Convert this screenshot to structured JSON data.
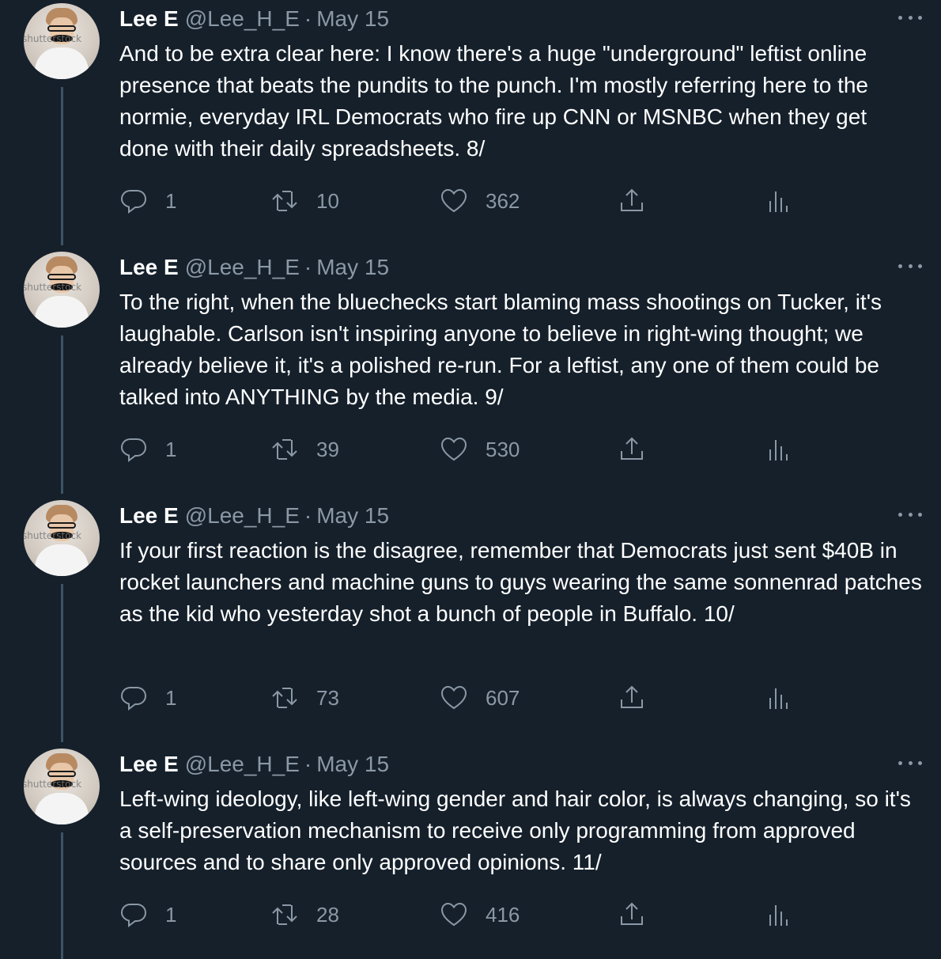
{
  "tweets": [
    {
      "name": "Lee E",
      "handle": "@Lee_H_E",
      "separator": "·",
      "date": "May 15",
      "avatar_watermark": "shutterstock",
      "text": "And to be extra clear here: I know there's a huge \"underground\" leftist online presence that beats the pundits to the punch. I'm mostly referring here to the normie, everyday IRL Democrats who fire up CNN or MSNBC when they get done with their daily spreadsheets. 8/",
      "replies": "1",
      "retweets": "10",
      "likes": "362"
    },
    {
      "name": "Lee E",
      "handle": "@Lee_H_E",
      "separator": "·",
      "date": "May 15",
      "avatar_watermark": "shutterstock",
      "text": "To the right, when the bluechecks start blaming mass shootings on Tucker, it's laughable. Carlson isn't inspiring anyone to believe in right-wing thought; we already believe it, it's a polished re-run. For a leftist, any one of them could be talked into ANYTHING by the media. 9/",
      "replies": "1",
      "retweets": "39",
      "likes": "530"
    },
    {
      "name": "Lee E",
      "handle": "@Lee_H_E",
      "separator": "·",
      "date": "May 15",
      "avatar_watermark": "shutterstock",
      "text": "If your first reaction is the disagree, remember that Democrats just sent $40B in rocket launchers and machine guns to guys wearing the same sonnenrad patches as the kid who yesterday shot a bunch of people in Buffalo. 10/",
      "replies": "1",
      "retweets": "73",
      "likes": "607"
    },
    {
      "name": "Lee E",
      "handle": "@Lee_H_E",
      "separator": "·",
      "date": "May 15",
      "avatar_watermark": "shutterstock",
      "text": "Left-wing ideology, like left-wing gender and hair color, is always changing, so it's a self-preservation mechanism to receive only programming from approved sources and to share only approved opinions. 11/",
      "replies": "1",
      "retweets": "28",
      "likes": "416"
    }
  ],
  "icons": {
    "reply": "reply-icon",
    "retweet": "retweet-icon",
    "like": "heart-icon",
    "share": "share-icon",
    "analytics": "analytics-icon",
    "more": "more-icon"
  },
  "colors": {
    "background": "#15202b",
    "text": "#ffffff",
    "secondary": "#8b98a5",
    "thread_line": "#3d5466"
  }
}
